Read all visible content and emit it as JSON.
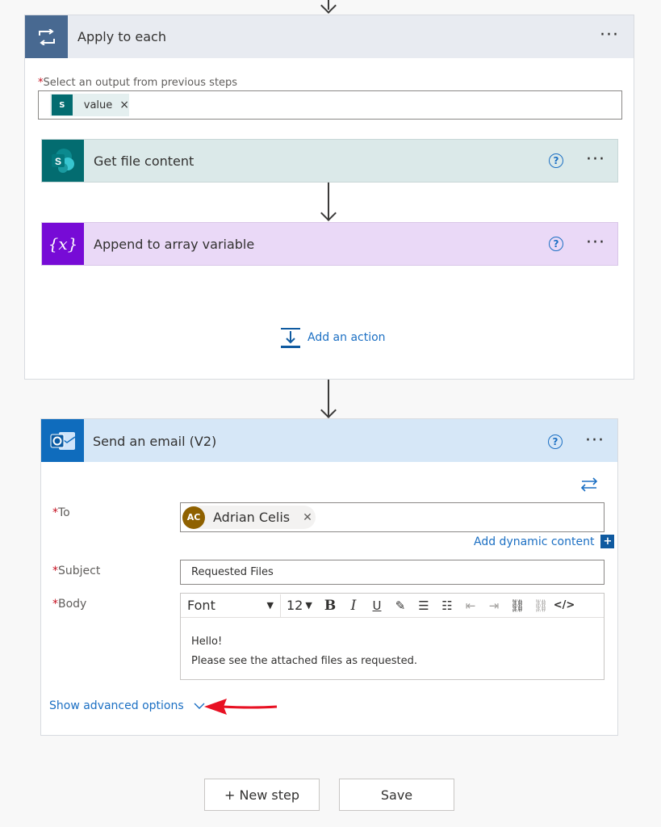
{
  "apply_each": {
    "title": "Apply to each",
    "more": "···",
    "select_label": "Select an output from previous steps",
    "token_value": "value",
    "token_remove": "×",
    "required_mark": "*"
  },
  "get_file": {
    "title": "Get file content",
    "help": "?",
    "more": "···"
  },
  "append": {
    "title": "Append to array variable",
    "help": "?",
    "more": "···",
    "icon_text": "{x}"
  },
  "add_action": {
    "label": "Add an action"
  },
  "email": {
    "title": "Send an email (V2)",
    "help": "?",
    "more": "···",
    "to_label": "To",
    "to_initials": "AC",
    "to_name": "Adrian Celis",
    "to_remove": "✕",
    "add_dynamic": "Add dynamic content",
    "add_dynamic_plus": "+",
    "subject_label": "Subject",
    "subject_value": "Requested Files",
    "body_label": "Body",
    "font_select": "Font",
    "size_select": "12",
    "body_line1": "Hello!",
    "body_line2": "Please see the attached files as requested.",
    "advanced": "Show advanced options"
  },
  "footer": {
    "new_step": "+ New step",
    "save": "Save"
  },
  "colors": {
    "apply_blue": "#486991",
    "sharepoint_teal": "#036c70",
    "variable_purple": "#770bd6",
    "outlook_blue": "#0f6cbd",
    "link_blue": "#1b6fc3",
    "annotation_red": "#e81123"
  }
}
